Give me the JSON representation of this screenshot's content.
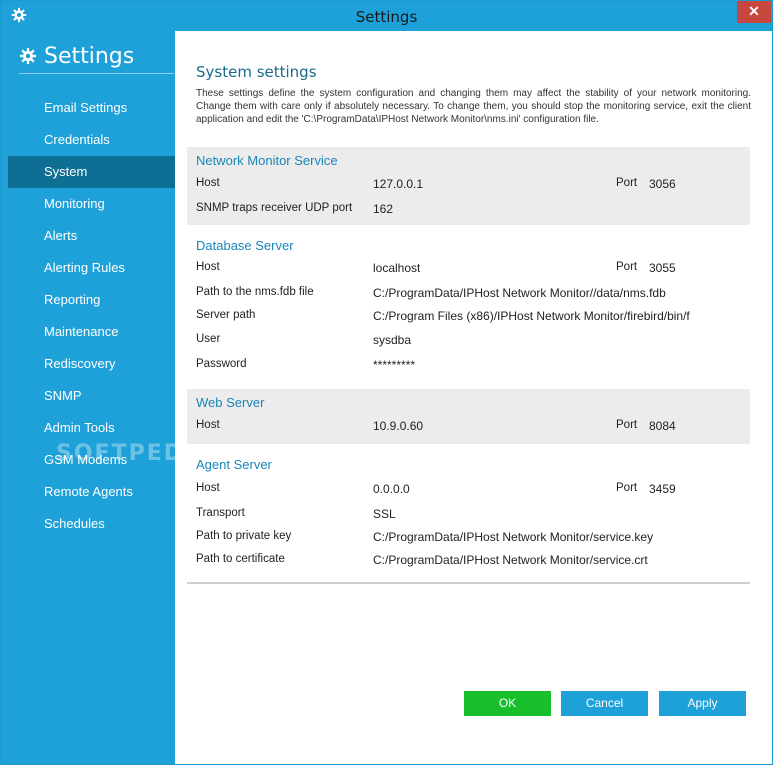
{
  "window": {
    "title": "Settings",
    "close_glyph": "✕"
  },
  "sidebar": {
    "header": "Settings",
    "items": [
      {
        "label": "Email Settings",
        "active": false
      },
      {
        "label": "Credentials",
        "active": false
      },
      {
        "label": "System",
        "active": true
      },
      {
        "label": "Monitoring",
        "active": false
      },
      {
        "label": "Alerts",
        "active": false
      },
      {
        "label": "Alerting Rules",
        "active": false
      },
      {
        "label": "Reporting",
        "active": false
      },
      {
        "label": "Maintenance",
        "active": false
      },
      {
        "label": "Rediscovery",
        "active": false
      },
      {
        "label": "SNMP",
        "active": false
      },
      {
        "label": "Admin Tools",
        "active": false
      },
      {
        "label": "GSM Modems",
        "active": false
      },
      {
        "label": "Remote Agents",
        "active": false
      },
      {
        "label": "Schedules",
        "active": false
      }
    ]
  },
  "main": {
    "title": "System settings",
    "description": "These settings define the system configuration and changing them may affect the stability of your network monitoring. Change them with care only if absolutely necessary. To change them, you should stop the monitoring service, exit the client application and edit the 'C:\\ProgramData\\IPHost Network Monitor\\nms.ini' configuration file.",
    "sections": {
      "nms": {
        "title": "Network Monitor Service",
        "host_label": "Host",
        "host_value": "127.0.0.1",
        "port_label": "Port",
        "port_value": "3056",
        "snmp_label": "SNMP traps receiver UDP port",
        "snmp_value": "162"
      },
      "db": {
        "title": "Database Server",
        "host_label": "Host",
        "host_value": "localhost",
        "port_label": "Port",
        "port_value": "3055",
        "fdb_label": "Path to the nms.fdb file",
        "fdb_value": "C:/ProgramData/IPHost Network Monitor//data/nms.fdb",
        "server_path_label": "Server path",
        "server_path_value": "C:/Program Files (x86)/IPHost Network Monitor/firebird/bin/f",
        "user_label": "User",
        "user_value": "sysdba",
        "password_label": "Password",
        "password_value": "*********"
      },
      "web": {
        "title": "Web Server",
        "host_label": "Host",
        "host_value": "10.9.0.60",
        "port_label": "Port",
        "port_value": "8084"
      },
      "agent": {
        "title": "Agent Server",
        "host_label": "Host",
        "host_value": "0.0.0.0",
        "port_label": "Port",
        "port_value": "3459",
        "transport_label": "Transport",
        "transport_value": "SSL",
        "key_label": "Path to private key",
        "key_value": "C:/ProgramData/IPHost Network Monitor/service.key",
        "cert_label": "Path to certificate",
        "cert_value": "C:/ProgramData/IPHost Network Monitor/service.crt"
      }
    }
  },
  "buttons": {
    "ok": "OK",
    "cancel": "Cancel",
    "apply": "Apply"
  },
  "watermark": "SOFTPEDIA",
  "colors": {
    "accent": "#1ea1d8",
    "active_nav": "#0e6e94",
    "ok": "#17c02a",
    "close": "#c7463d",
    "section_title": "#1986ba"
  },
  "icons": {
    "app": "gear-icon",
    "sidebar_header": "gear-icon",
    "close": "close-icon"
  }
}
